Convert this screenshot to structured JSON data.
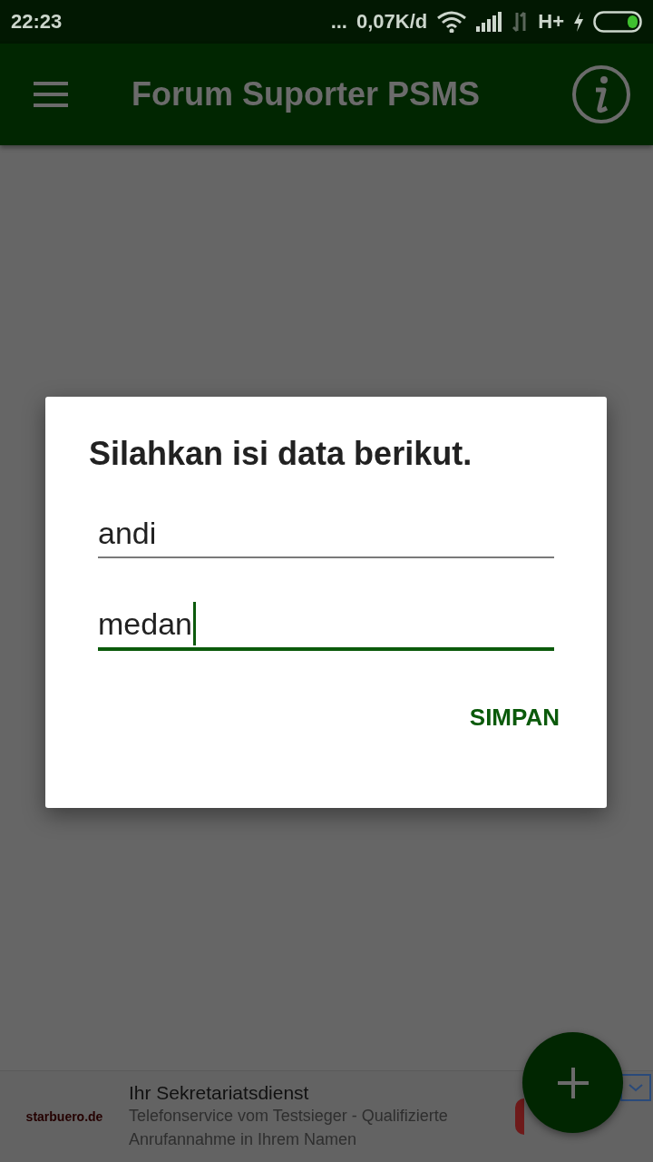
{
  "status_bar": {
    "time": "22:23",
    "more": "...",
    "speed": "0,07K/d",
    "network": "H+"
  },
  "app_bar": {
    "title": "Forum Suporter PSMS"
  },
  "dialog": {
    "title": "Silahkan isi data berikut.",
    "fields": [
      {
        "value": "andi",
        "focused": false
      },
      {
        "value": "medan",
        "focused": true
      }
    ],
    "button": "SIMPAN"
  },
  "ad": {
    "logo": "starbuero.de",
    "title": "Ihr Sekretariatsdienst",
    "text": "Telefonservice vom Testsieger - Qualifizierte Anrufannahme in Ihrem Namen"
  }
}
